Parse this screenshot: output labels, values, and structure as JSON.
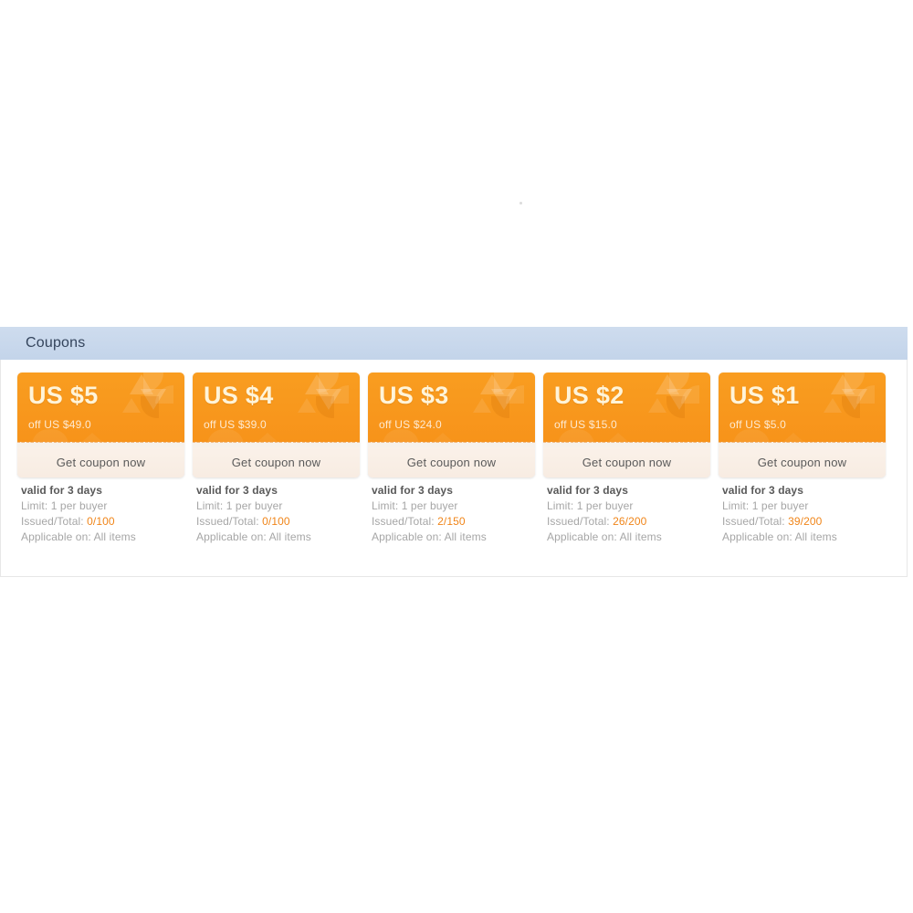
{
  "module": {
    "header_title": "Coupons"
  },
  "colors": {
    "header_bar": "#c9d9ee",
    "header_text": "#34445c",
    "ticket_orange": "#f7931a",
    "ticket_amount_text": "#fff4d9",
    "cta_background": "#faf0e7",
    "cta_text": "#5a5a5a",
    "meta_text": "#a6a6a6",
    "meta_strong_text": "#595959",
    "meta_number_accent": "#f08519",
    "page_background": "#ffffff"
  },
  "coupons": [
    {
      "amount": "US $5",
      "condition": "off US $49.0",
      "cta_label": "Get coupon now",
      "validity": "valid for 3 days",
      "limit_label": "Limit: ",
      "limit_value": "1 per buyer",
      "issued_label": "Issued/Total: ",
      "issued_value": "0/100",
      "applicable_label": "Applicable on: ",
      "applicable_value": "All items"
    },
    {
      "amount": "US $4",
      "condition": "off US $39.0",
      "cta_label": "Get coupon now",
      "validity": "valid for 3 days",
      "limit_label": "Limit: ",
      "limit_value": "1 per buyer",
      "issued_label": "Issued/Total: ",
      "issued_value": "0/100",
      "applicable_label": "Applicable on: ",
      "applicable_value": "All items"
    },
    {
      "amount": "US $3",
      "condition": "off US $24.0",
      "cta_label": "Get coupon now",
      "validity": "valid for 3 days",
      "limit_label": "Limit: ",
      "limit_value": "1 per buyer",
      "issued_label": "Issued/Total: ",
      "issued_value": "2/150",
      "applicable_label": "Applicable on: ",
      "applicable_value": "All items"
    },
    {
      "amount": "US $2",
      "condition": "off US $15.0",
      "cta_label": "Get coupon now",
      "validity": "valid for 3 days",
      "limit_label": "Limit: ",
      "limit_value": "1 per buyer",
      "issued_label": "Issued/Total: ",
      "issued_value": "26/200",
      "applicable_label": "Applicable on: ",
      "applicable_value": "All items"
    },
    {
      "amount": "US $1",
      "condition": "off US $5.0",
      "cta_label": "Get coupon now",
      "validity": "valid for 3 days",
      "limit_label": "Limit: ",
      "limit_value": "1 per buyer",
      "issued_label": "Issued/Total: ",
      "issued_value": "39/200",
      "applicable_label": "Applicable on: ",
      "applicable_value": "All items"
    }
  ]
}
